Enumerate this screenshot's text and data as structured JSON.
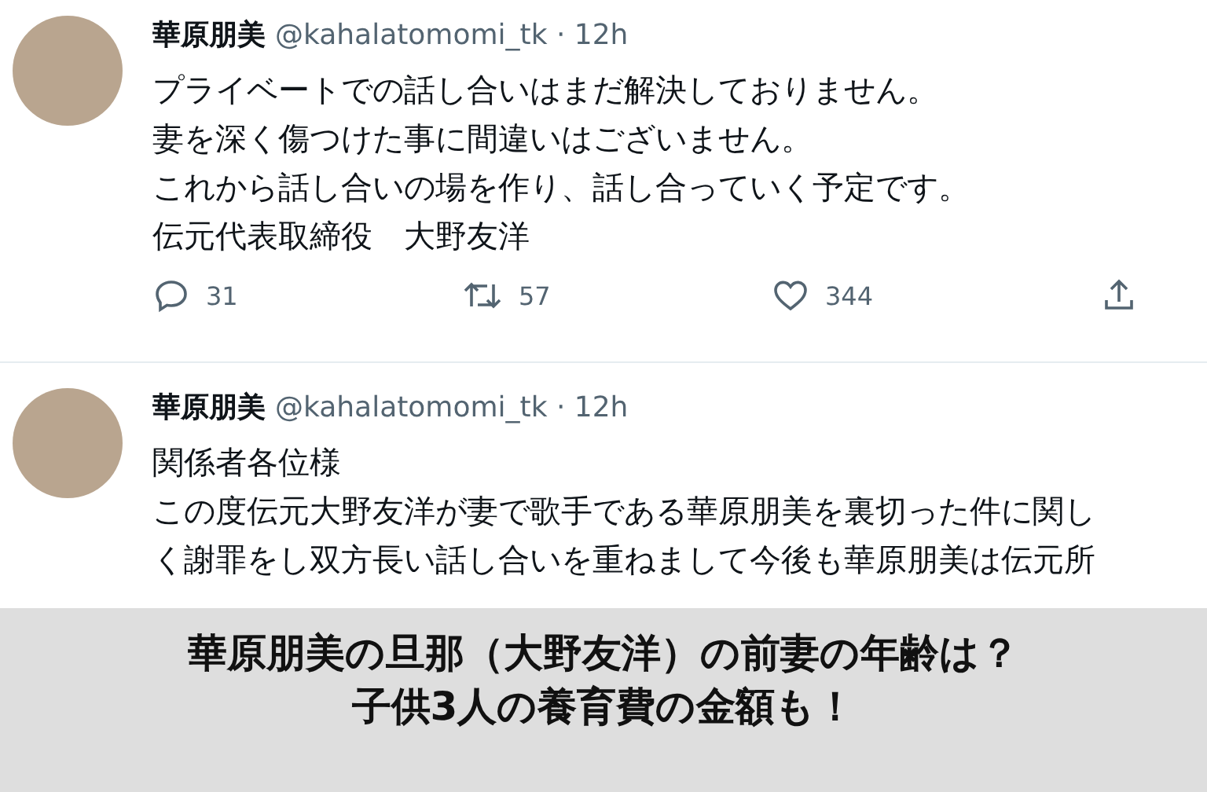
{
  "tweets": [
    {
      "author": "華原朋美",
      "meta": "@kahalatomomi_tk · 12h",
      "lines": [
        "プライベートでの話し合いはまだ解決しておりません。",
        "妻を深く傷つけた事に間違いはございません。",
        "これから話し合いの場を作り、話し合っていく予定です。",
        "伝元代表取締役　大野友洋"
      ],
      "replies": "31",
      "retweets": "57",
      "likes": "344"
    },
    {
      "author": "華原朋美",
      "meta": "@kahalatomomi_tk · 12h",
      "lines": [
        "関係者各位様",
        "この度伝元大野友洋が妻で歌手である華原朋美を裏切った件に関し",
        "く謝罪をし双方長い話し合いを重ねまして今後も華原朋美は伝元所"
      ]
    }
  ],
  "banner": {
    "lines": [
      "華原朋美の旦那（大野友洋）の前妻の年齢は？",
      "子供3人の養育費の金額も！"
    ]
  }
}
